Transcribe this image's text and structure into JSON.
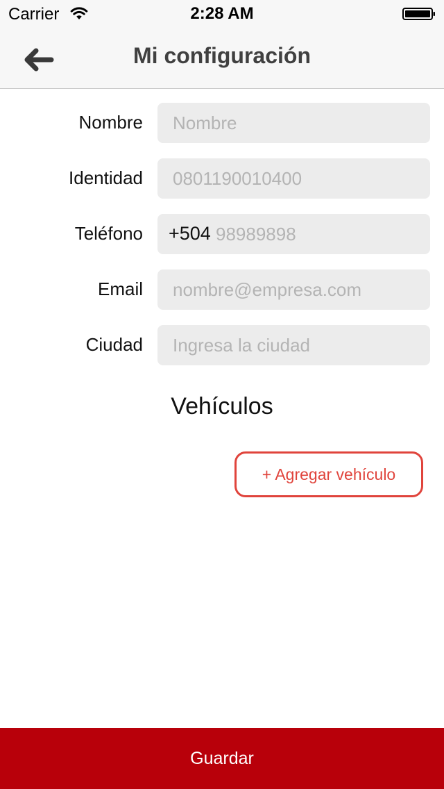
{
  "status_bar": {
    "carrier": "Carrier",
    "time": "2:28 AM",
    "wifi_icon": "wifi-icon",
    "battery_icon": "battery-icon"
  },
  "nav": {
    "title": "Mi configuración",
    "back_icon": "arrow-left-icon"
  },
  "form": {
    "nombre": {
      "label": "Nombre",
      "value": "",
      "placeholder": "Nombre"
    },
    "identidad": {
      "label": "Identidad",
      "value": "",
      "placeholder": "0801190010400"
    },
    "telefono": {
      "label": "Teléfono",
      "prefix": "+504",
      "value": "",
      "placeholder": "98989898"
    },
    "email": {
      "label": "Email",
      "value": "",
      "placeholder": "nombre@empresa.com"
    },
    "ciudad": {
      "label": "Ciudad",
      "value": "",
      "placeholder": "Ingresa la ciudad"
    }
  },
  "vehicles": {
    "title": "Vehículos",
    "add_label": "+ Agregar vehículo"
  },
  "footer": {
    "save_label": "Guardar"
  },
  "colors": {
    "accent": "#e0443c",
    "primary_button": "#b8000a",
    "field_background": "#ececec"
  }
}
